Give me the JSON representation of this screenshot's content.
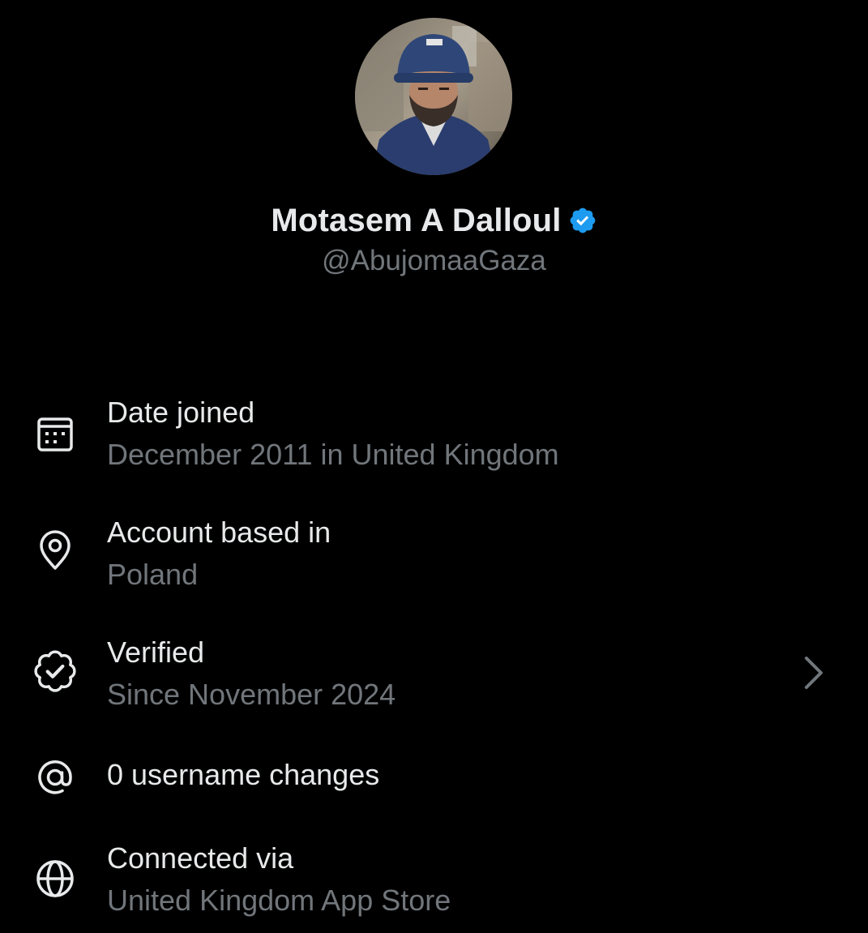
{
  "profile": {
    "display_name": "Motasem A Dalloul",
    "handle": "@AbujomaaGaza",
    "verified_badge_color": "#1d9bf0"
  },
  "about": {
    "date_joined": {
      "title": "Date joined",
      "value": "December 2011 in United Kingdom",
      "icon": "calendar-icon"
    },
    "account_based": {
      "title": "Account based in",
      "value": "Poland",
      "icon": "location-pin-icon"
    },
    "verified": {
      "title": "Verified",
      "value": "Since November 2024",
      "icon": "verified-badge-icon"
    },
    "username_changes": {
      "title": "0 username changes",
      "icon": "at-sign-icon"
    },
    "connected_via": {
      "title": "Connected via",
      "value": "United Kingdom App Store",
      "icon": "globe-icon"
    }
  },
  "colors": {
    "background": "#000000",
    "primary_text": "#e7e9ea",
    "secondary_text": "#71767b",
    "accent": "#1d9bf0"
  }
}
